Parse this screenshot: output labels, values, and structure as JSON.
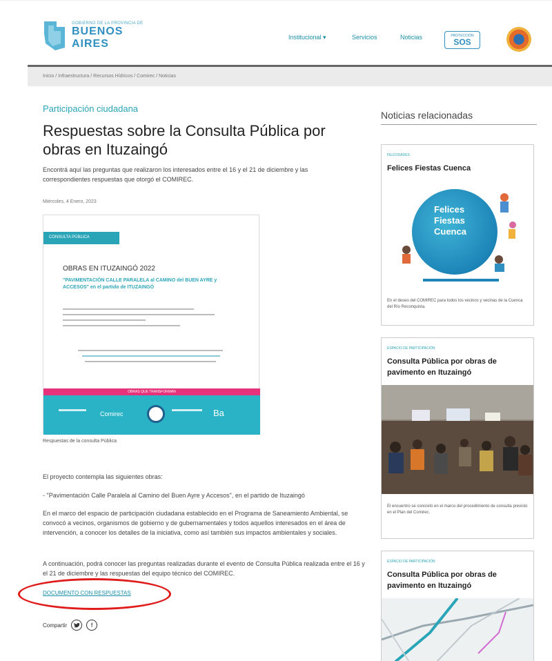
{
  "header": {
    "logo_small": "GOBIERNO DE LA PROVINCIA DE",
    "logo_big": "BUENOS AIRES",
    "nav": [
      "Institucional ▾",
      "Servicios",
      "Noticias"
    ],
    "sos_small": "PROTECCIÓN",
    "sos_big": "SOS"
  },
  "breadcrumb": "Inicio / Infraestructura / Recursos Hídricos / Comirec / Noticias",
  "article": {
    "category": "Participación ciudadana",
    "title": "Respuestas sobre la Consulta Pública por obras en Ituzaingó",
    "lead": "Encontrá aquí las preguntas que realizaron los interesados entre el 16 y el 21 de diciembre y las correspondientes respuestas que otorgó el COMIREC.",
    "date": "Miércoles, 4 Enero, 2023",
    "doc": {
      "tag": "CONSULTA PÚBLICA",
      "h1": "OBRAS EN ITUZAINGÓ 2022",
      "h2": "\"PAVIMENTACIÓN CALLE PARALELA al CAMINO del BUEN AYRE y ACCESOS\" en el partido de ITUZAINGÓ",
      "pink": "OBRAS QUE TRANSFORMAN",
      "foot_left": "Comirec",
      "foot_mid": "Ba"
    },
    "caption": "Respuestas de la consulta Pública",
    "p1": "El proyecto contempla las siguientes obras:",
    "p2": "- \"Pavimentación Calle Paralela al Camino del Buen Ayre y Accesos\", en el partido de Ituzaingó",
    "p3": "En el marco del espacio de participación ciudadana establecido en el Programa de Saneamiento Ambiental, se convocó a vecinos, organismos de gobierno y de gubernamentales y todos aquellos interesados en el área de intervención, a conocer los detalles de la iniciativa, como así también sus impactos ambientales y sociales.",
    "p4": "A continuación, podrá conocer las preguntas realizadas durante el evento de Consulta Pública realizada entre el 16 y el 21 de diciembre y las respuestas del equipo técnico del COMIREC.",
    "doc_link": "DOCUMENTO CON RESPUESTAS",
    "share_label": "Compartir",
    "share_icons": [
      "twitter-icon",
      "facebook-icon"
    ]
  },
  "sidebar": {
    "title": "Noticias relacionadas",
    "cards": [
      {
        "tag": "FELICIDADES",
        "title": "Felices Fiestas Cuenca",
        "image_text": "Felices Fiestas Cuenca",
        "desc": "En el deseo del COMIREC para todos los vecinos y vecinas de la Cuenca del Río Reconquista."
      },
      {
        "tag": "ESPACIO DE PARTICIPACIÓN",
        "title": "Consulta Pública por obras de pavimento en Ituzaingó",
        "desc": "El encuentro se concretó en el marco del procedimiento de consulta previsto en el Plan del Comirec."
      },
      {
        "tag": "ESPACIO DE PARTICIPACIÓN",
        "title": "Consulta Pública por obras de pavimento en Ituzaingó"
      }
    ]
  },
  "colors": {
    "accent": "#2aa5b8",
    "brand": "#2f8fc0",
    "pink": "#e6327a",
    "annotation": "#e01b1b"
  }
}
